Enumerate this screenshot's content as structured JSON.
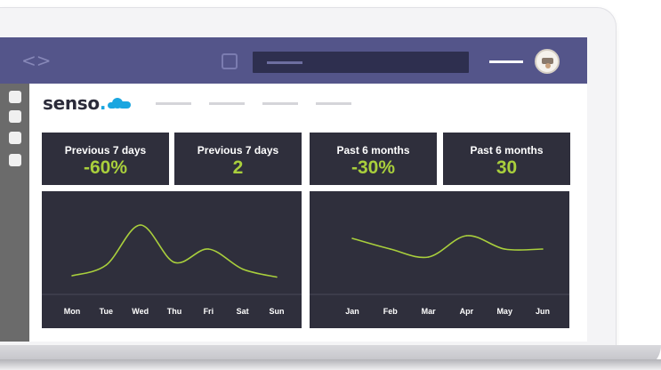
{
  "brand": {
    "name": "senso",
    "dot": "."
  },
  "stats": [
    {
      "label": "Previous 7 days",
      "value": "-60%"
    },
    {
      "label": "Previous 7 days",
      "value": "2"
    },
    {
      "label": "Past 6 months",
      "value": "-30%"
    },
    {
      "label": "Past 6 months",
      "value": "30"
    }
  ],
  "colors": {
    "topbar": "#54558a",
    "panel": "#2f2f3c",
    "accent_green": "#a9cf3c",
    "brand_blue": "#1aa6e0"
  },
  "icons": {
    "code": "code-icon",
    "window": "window-icon",
    "avatar": "avatar"
  },
  "chart_data": [
    {
      "type": "line",
      "x": [
        "Mon",
        "Tue",
        "Wed",
        "Thu",
        "Fri",
        "Sat",
        "Sun"
      ],
      "series": [
        {
          "values": [
            10,
            18,
            48,
            20,
            30,
            15,
            9
          ]
        }
      ],
      "ylim": [
        0,
        60
      ],
      "grid": false
    },
    {
      "type": "line",
      "x": [
        "Jan",
        "Feb",
        "Mar",
        "Apr",
        "May",
        "Jun"
      ],
      "series": [
        {
          "values": [
            38,
            30,
            24,
            40,
            30,
            30
          ]
        }
      ],
      "ylim": [
        0,
        60
      ],
      "grid": false
    }
  ]
}
